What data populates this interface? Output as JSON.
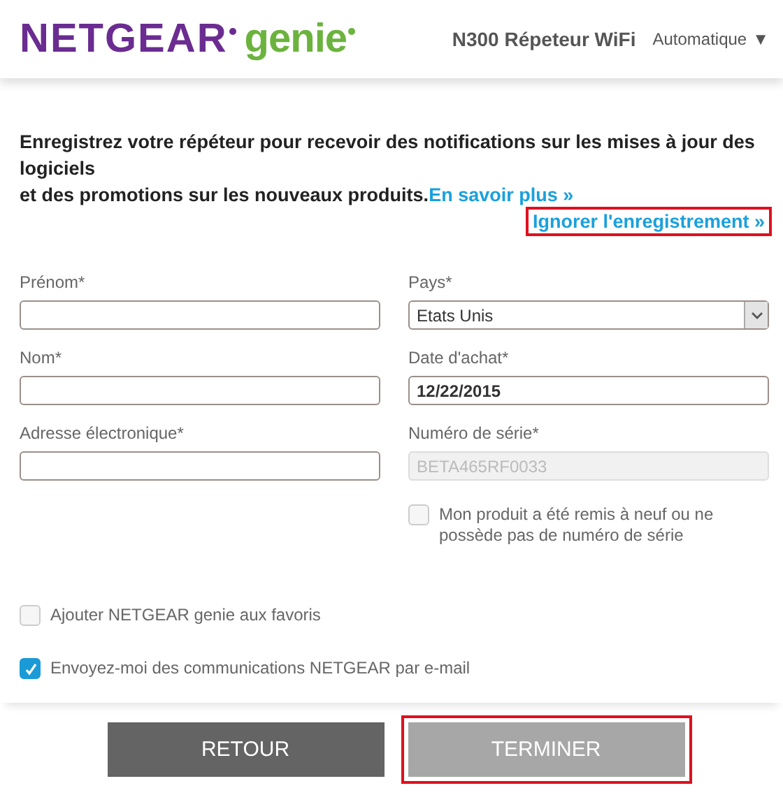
{
  "header": {
    "logo": {
      "brand": "NETGEAR",
      "product": "genie"
    },
    "device": "N300 Répeteur WiFi",
    "language": {
      "value": "Automatique",
      "caret": "▼"
    }
  },
  "intro": {
    "text": "Enregistrez votre répéteur pour recevoir des notifications sur les mises à jour des logiciels",
    "text2": "et des promotions sur les nouveaux produits.",
    "link": "En savoir plus »"
  },
  "skip_link": {
    "label": "Ignorer l'enregistrement »",
    "highlighted": true
  },
  "fields_left": [
    {
      "label": "Prénom*"
    },
    {
      "label": "Nom*"
    },
    {
      "label": "Adresse électronique*"
    }
  ],
  "fields_right": [
    {
      "label": "Pays*",
      "kind": "select",
      "value": "Etats Unis"
    },
    {
      "label": "Date d'achat*",
      "kind": "text",
      "value": "12/22/2015"
    },
    {
      "label": "Numéro de série*",
      "kind": "text",
      "value": "BETA465RF0033",
      "disabled": true
    }
  ],
  "refurbished": {
    "label": "Mon produit a été remis à neuf ou ne possède pas de numéro de série",
    "checked": false
  },
  "options": [
    {
      "label": "Ajouter NETGEAR genie aux favoris",
      "checked": false
    },
    {
      "label": "Envoyez-moi des communications NETGEAR par e-mail",
      "checked": true
    }
  ],
  "buttons": [
    {
      "label": "RETOUR",
      "kind": "dark",
      "highlighted": false
    },
    {
      "label": "TERMINER",
      "kind": "light",
      "highlighted": true
    }
  ]
}
